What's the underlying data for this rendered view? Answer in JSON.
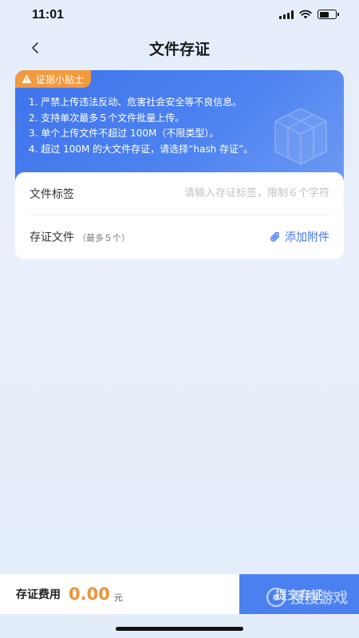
{
  "status_bar": {
    "time": "11:01",
    "battery_level": 0.6
  },
  "nav": {
    "title": "文件存证",
    "back_icon": "chevron-left-icon"
  },
  "tips": {
    "badge": "证据小贴士",
    "badge_icon": "warning-icon",
    "items": [
      "1. 严禁上传违法反动、危害社会安全等不良信息。",
      "2. 支持单次最多５个文件批量上传。",
      "3. 单个上传文件不超过 100M（不限类型）。",
      "4. 超过 100M 的大文件存证，请选择“hash 存证”。"
    ],
    "colors": {
      "card": "#4d82f0",
      "badge": "#f29a3e"
    }
  },
  "form": {
    "tag_label": "文件标签",
    "tag_value": "",
    "tag_placeholder": "请输入存证标签，限制６个字符",
    "file_label": "存证文件",
    "file_sub": "（最多５个）",
    "add_attachment": "添加附件",
    "attach_icon": "paperclip-icon"
  },
  "footer": {
    "fee_label": "存证费用",
    "fee_amount": "0.00",
    "fee_unit": "元",
    "submit": "提交存证",
    "colors": {
      "amount": "#f0923a",
      "submit": "#4a80ef"
    }
  },
  "watermark": {
    "text": "搜搜游戏"
  }
}
